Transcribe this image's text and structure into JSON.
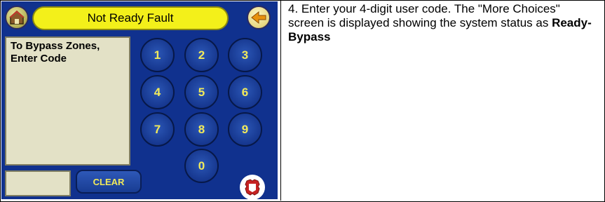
{
  "keypad_screen": {
    "title": "Not Ready Fault",
    "message": "To Bypass Zones,\nEnter Code",
    "keys": [
      "1",
      "2",
      "3",
      "4",
      "5",
      "6",
      "7",
      "8",
      "9",
      "0"
    ],
    "clear_label": "CLEAR",
    "code_value": "",
    "icons": {
      "home": "home-icon",
      "back": "back-arrow-icon",
      "panic": "panic-shield-icon"
    },
    "colors": {
      "screen_background": "#10318e",
      "title_bar": "#f3f01a",
      "key_label": "#f2ea5a",
      "message_panel": "#e3e1c6",
      "panic_red": "#c62222"
    }
  },
  "instructions": {
    "step_text": "4.  Enter your 4-digit user code.  The \"More Choices\" screen is displayed showing the system status as ",
    "status_bold": "Ready-Bypass"
  }
}
